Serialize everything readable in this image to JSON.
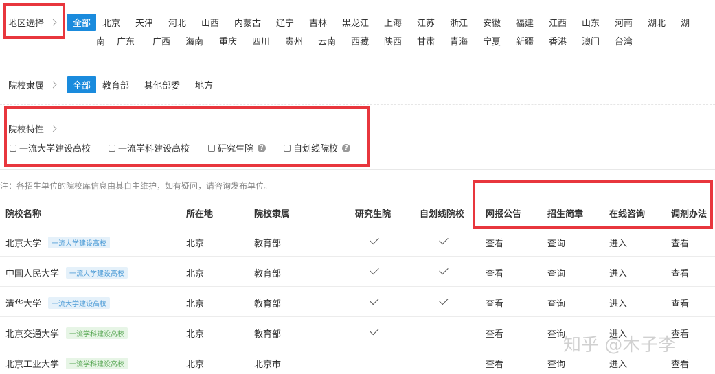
{
  "region": {
    "label": "地区选择",
    "options": [
      "全部",
      "北京",
      "天津",
      "河北",
      "山西",
      "内蒙古",
      "辽宁",
      "吉林",
      "黑龙江",
      "上海",
      "江苏",
      "浙江",
      "安徽",
      "福建",
      "江西",
      "山东",
      "河南",
      "湖北",
      "湖南",
      "广东",
      "广西",
      "海南",
      "重庆",
      "四川",
      "贵州",
      "云南",
      "西藏",
      "陕西",
      "甘肃",
      "青海",
      "宁夏",
      "新疆",
      "香港",
      "澳门",
      "台湾"
    ],
    "hunan_part1": "湖",
    "hunan_part2": "南"
  },
  "affiliation": {
    "label": "院校隶属",
    "options": [
      "全部",
      "教育部",
      "其他部委",
      "地方"
    ]
  },
  "features": {
    "label": "院校特性",
    "options": [
      "一流大学建设高校",
      "一流学科建设高校",
      "研究生院",
      "自划线院校"
    ],
    "help_icon": "question-mark-icon"
  },
  "note": "注：各招生单位的院校库信息由其自主维护，如有疑问，请咨询发布单位。",
  "table": {
    "headers": [
      "院校名称",
      "所在地",
      "院校隶属",
      "研究生院",
      "自划线院校",
      "网报公告",
      "招生简章",
      "在线咨询",
      "调剂办法"
    ],
    "rows": [
      {
        "name": "北京大学",
        "tag": "一流大学建设高校",
        "tag_type": "blue",
        "loc": "北京",
        "aff": "教育部",
        "grad": true,
        "self": true,
        "c1": "查看",
        "c2": "查询",
        "c3": "进入",
        "c4": "查看"
      },
      {
        "name": "中国人民大学",
        "tag": "一流大学建设高校",
        "tag_type": "blue",
        "loc": "北京",
        "aff": "教育部",
        "grad": true,
        "self": true,
        "c1": "查看",
        "c2": "查询",
        "c3": "进入",
        "c4": "查看"
      },
      {
        "name": "清华大学",
        "tag": "一流大学建设高校",
        "tag_type": "blue",
        "loc": "北京",
        "aff": "教育部",
        "grad": true,
        "self": true,
        "c1": "查看",
        "c2": "查询",
        "c3": "进入",
        "c4": "查看"
      },
      {
        "name": "北京交通大学",
        "tag": "一流学科建设高校",
        "tag_type": "green",
        "loc": "北京",
        "aff": "教育部",
        "grad": true,
        "self": false,
        "c1": "查看",
        "c2": "查询",
        "c3": "进入",
        "c4": "查看"
      },
      {
        "name": "北京工业大学",
        "tag": "一流学科建设高校",
        "tag_type": "green",
        "loc": "北京",
        "aff": "北京市",
        "grad": false,
        "self": false,
        "c1": "查看",
        "c2": "查询",
        "c3": "进入",
        "c4": "查看"
      }
    ]
  },
  "watermark": "知乎 @木子李",
  "colors": {
    "accent": "#1a8bdd",
    "highlight": "#e8363d"
  }
}
